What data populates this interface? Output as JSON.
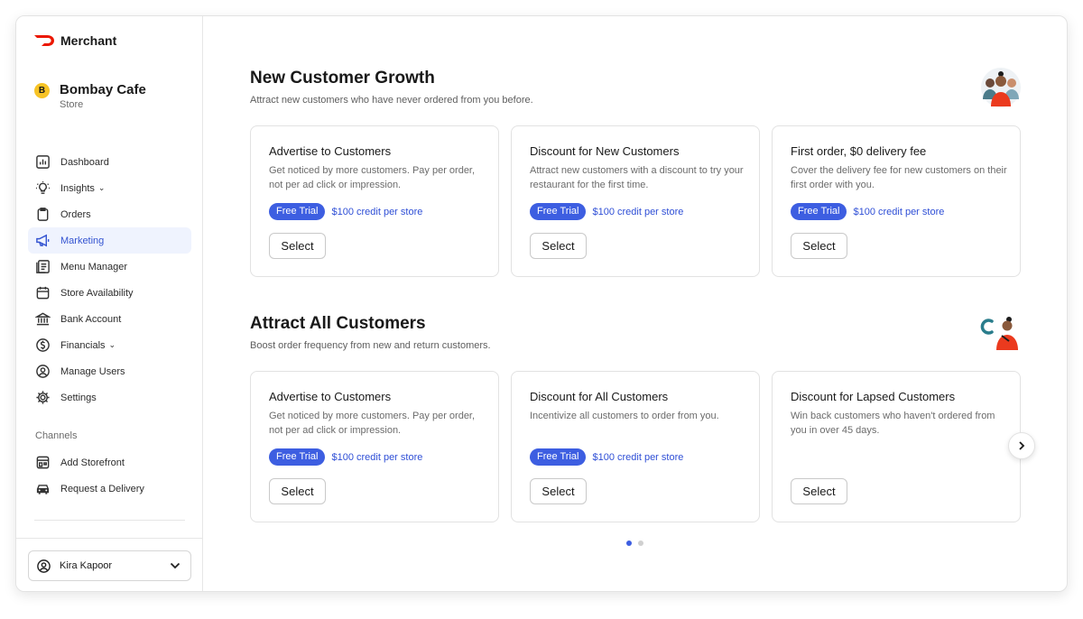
{
  "brand": {
    "name": "Merchant",
    "accent": "#eb1700"
  },
  "store": {
    "badge": "B",
    "name": "Bombay Cafe",
    "type": "Store"
  },
  "nav": {
    "items": [
      {
        "label": "Dashboard",
        "icon": "dashboard-icon"
      },
      {
        "label": "Insights",
        "icon": "lightbulb-icon",
        "dropdown": true
      },
      {
        "label": "Orders",
        "icon": "clipboard-icon"
      },
      {
        "label": "Marketing",
        "icon": "megaphone-icon",
        "active": true
      },
      {
        "label": "Menu Manager",
        "icon": "menu-icon"
      },
      {
        "label": "Store Availability",
        "icon": "calendar-icon"
      },
      {
        "label": "Bank Account",
        "icon": "bank-icon"
      },
      {
        "label": "Financials",
        "icon": "dollar-icon",
        "dropdown": true
      },
      {
        "label": "Manage Users",
        "icon": "user-circle-icon"
      },
      {
        "label": "Settings",
        "icon": "gear-icon"
      }
    ],
    "chev": "⌄"
  },
  "channels": {
    "label": "Channels",
    "items": [
      {
        "label": "Add Storefront",
        "icon": "storefront-icon"
      },
      {
        "label": "Request a Delivery",
        "icon": "car-icon"
      }
    ]
  },
  "user": {
    "name": "Kira Kapoor"
  },
  "sections": [
    {
      "title": "New Customer Growth",
      "subtitle": "Attract new customers who have never ordered from you before.",
      "cards": [
        {
          "title": "Advertise to Customers",
          "desc": "Get noticed by more customers. Pay per order, not per ad click or impression.",
          "badge": "Free Trial",
          "credit": "$100 credit per store",
          "button": "Select"
        },
        {
          "title": "Discount for New Customers",
          "desc": "Attract new customers with a discount to try your restaurant for the first time.",
          "badge": "Free Trial",
          "credit": "$100 credit per store",
          "button": "Select"
        },
        {
          "title": "First order, $0 delivery fee",
          "desc": "Cover the delivery fee for new customers on their first order with you.",
          "badge": "Free Trial",
          "credit": "$100 credit per store",
          "button": "Select"
        }
      ]
    },
    {
      "title": "Attract All Customers",
      "subtitle": "Boost order frequency from new and return customers.",
      "cards": [
        {
          "title": "Advertise to Customers",
          "desc": "Get noticed by more customers. Pay per order, not per ad click or impression.",
          "badge": "Free Trial",
          "credit": "$100 credit per store",
          "button": "Select"
        },
        {
          "title": "Discount for All Customers",
          "desc": "Incentivize all customers to order from you.",
          "badge": "Free Trial",
          "credit": "$100 credit per store",
          "button": "Select"
        },
        {
          "title": "Discount for Lapsed Customers",
          "desc": "Win back customers who haven't ordered from you in over 45 days.",
          "button": "Select"
        }
      ]
    }
  ],
  "pagination": {
    "pages": 2,
    "current": 1
  },
  "colors": {
    "accent_blue": "#3d5ee1",
    "active_bg": "#eff3fe",
    "badge_yellow": "#f7c326"
  }
}
